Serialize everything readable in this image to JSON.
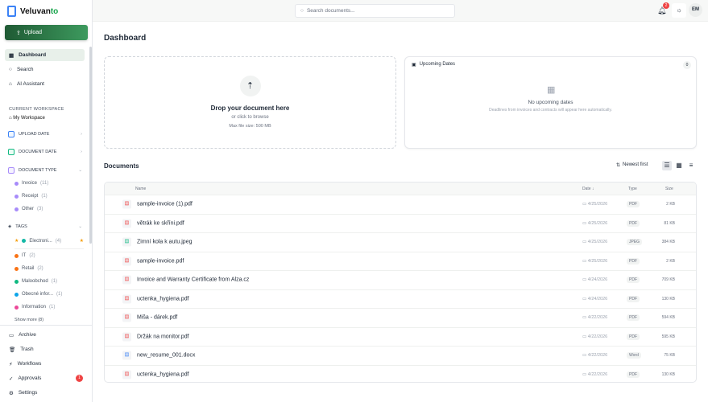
{
  "app": {
    "name_a": "Veluvan",
    "name_b": "to"
  },
  "sidebar": {
    "upload_label": "Upload",
    "nav": [
      {
        "label": "Dashboard",
        "icon": "grid-icon"
      },
      {
        "label": "Search",
        "icon": "search-icon"
      },
      {
        "label": "AI Assistant",
        "icon": "robot-icon"
      }
    ],
    "workspace_heading": "CURRENT WORKSPACE",
    "workspace": "My Workspace",
    "groups": {
      "upload_date": "UPLOAD DATE",
      "document_date": "DOCUMENT DATE",
      "document_type": "DOCUMENT TYPE",
      "tags": "TAGS"
    },
    "types": [
      {
        "label": "Invoice",
        "count": "(11)"
      },
      {
        "label": "Receipt",
        "count": "(1)"
      },
      {
        "label": "Other",
        "count": "(3)"
      }
    ],
    "pinned_tag": {
      "label": "Electroni...",
      "count": "(4)"
    },
    "tags": [
      {
        "label": "IT",
        "count": "(2)",
        "color": "#f97316"
      },
      {
        "label": "Retail",
        "count": "(2)",
        "color": "#f97316"
      },
      {
        "label": "Maloobchod",
        "count": "(1)",
        "color": "#10b981"
      },
      {
        "label": "Obecné infor...",
        "count": "(1)",
        "color": "#0ea5e9"
      },
      {
        "label": "Information",
        "count": "(1)",
        "color": "#ec4899"
      }
    ],
    "show_more": "Show more (8)",
    "bottom": [
      {
        "label": "Archive",
        "icon": "archive-icon"
      },
      {
        "label": "Trash",
        "icon": "trash-icon"
      },
      {
        "label": "Workflows",
        "icon": "workflow-icon"
      },
      {
        "label": "Approvals",
        "icon": "approval-icon",
        "badge": "1"
      },
      {
        "label": "Settings",
        "icon": "gear-icon"
      }
    ]
  },
  "topbar": {
    "search_placeholder": "Search documents...",
    "notifications": "2",
    "avatar": "EM"
  },
  "main": {
    "title": "Dashboard",
    "drop": {
      "title": "Drop your document here",
      "sub": "or click to browse",
      "limit": "Max file size: 500 MB"
    },
    "upcoming": {
      "title": "Upcoming Dates",
      "count": "0",
      "empty": "No upcoming dates",
      "hint": "Deadlines from invoices and contracts will appear here automatically."
    },
    "documents": {
      "title": "Documents",
      "sort": "Newest first",
      "headers": {
        "name": "Name",
        "date": "Date ↓",
        "type": "Type",
        "size": "Size"
      },
      "rows": [
        {
          "name": "sample-invoice (1).pdf",
          "date": "4/25/2026",
          "type": "PDF",
          "size": "2 KB",
          "kind": "pdf"
        },
        {
          "name": "větrák ke skříni.pdf",
          "date": "4/25/2026",
          "type": "PDF",
          "size": "81 KB",
          "kind": "pdf"
        },
        {
          "name": "Zimní kola k autu.jpeg",
          "date": "4/25/2026",
          "type": "JPEG",
          "size": "384 KB",
          "kind": "img"
        },
        {
          "name": "sample-invoice.pdf",
          "date": "4/25/2026",
          "type": "PDF",
          "size": "2 KB",
          "kind": "pdf"
        },
        {
          "name": "Invoice and Warranty Certificate from Alza.cz",
          "date": "4/24/2026",
          "type": "PDF",
          "size": "709 KB",
          "kind": "pdf"
        },
        {
          "name": "uctenka_hygiena.pdf",
          "date": "4/24/2026",
          "type": "PDF",
          "size": "130 KB",
          "kind": "pdf"
        },
        {
          "name": "Miša - dárek.pdf",
          "date": "4/22/2026",
          "type": "PDF",
          "size": "594 KB",
          "kind": "pdf"
        },
        {
          "name": "Držák na monitor.pdf",
          "date": "4/22/2026",
          "type": "PDF",
          "size": "595 KB",
          "kind": "pdf"
        },
        {
          "name": "new_resume_001.docx",
          "date": "4/22/2026",
          "type": "Word",
          "size": "75 KB",
          "kind": "doc"
        },
        {
          "name": "uctenka_hygiena.pdf",
          "date": "4/22/2026",
          "type": "PDF",
          "size": "130 KB",
          "kind": "pdf"
        }
      ]
    }
  }
}
